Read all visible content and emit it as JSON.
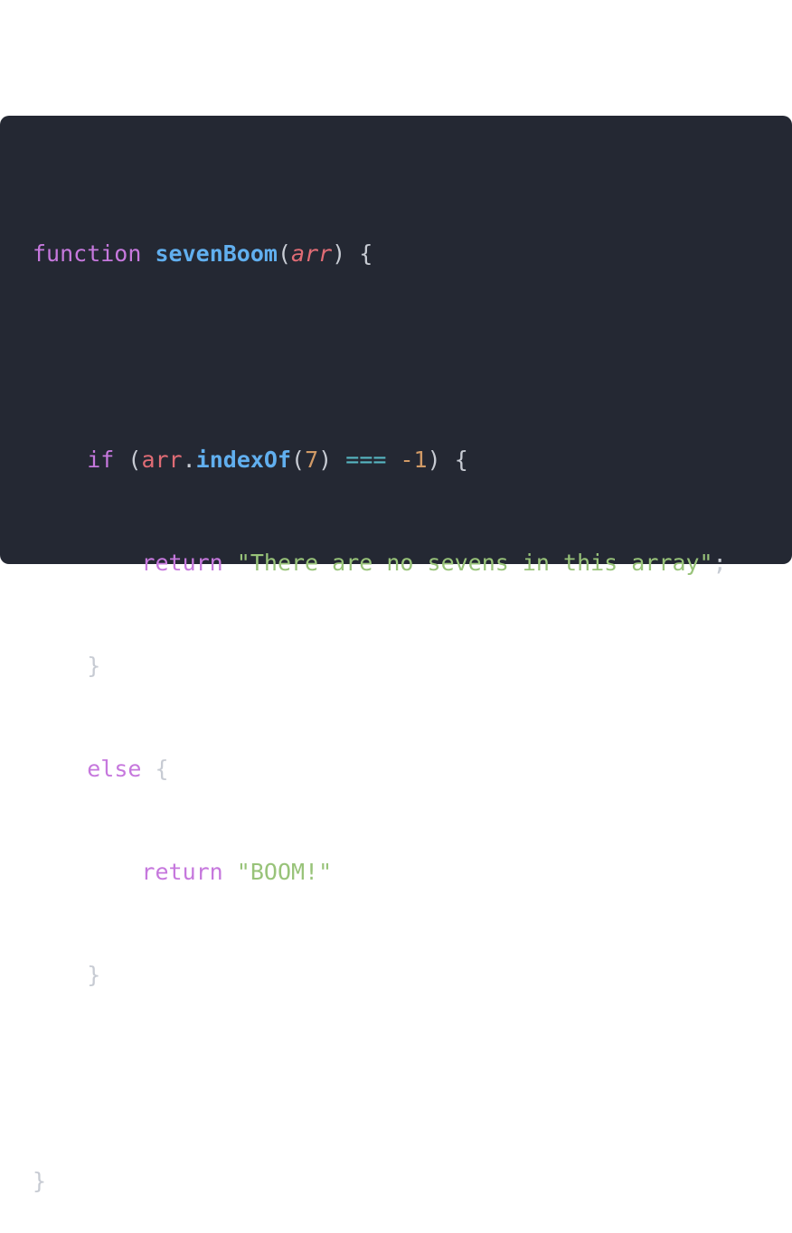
{
  "code": {
    "line1": {
      "kw_function": "function",
      "fn_name": "sevenBoom",
      "open_paren": "(",
      "param": "arr",
      "close_brace_open": ") {"
    },
    "line3": {
      "kw_if": "if",
      "open_paren": "(",
      "var": "arr",
      "dot": ".",
      "method": "indexOf",
      "arg_open": "(",
      "arg": "7",
      "arg_close": ")",
      "op": "===",
      "neg": "-1",
      "close": ") {"
    },
    "line4": {
      "kw_return": "return",
      "string": "\"There are no sevens in this array\"",
      "semi": ";"
    },
    "line5": {
      "brace": "}"
    },
    "line6": {
      "kw_else": "else",
      "brace": "{"
    },
    "line7": {
      "kw_return": "return",
      "string": "\"BOOM!\""
    },
    "line8": {
      "brace": "}"
    },
    "line10": {
      "brace": "}"
    }
  }
}
